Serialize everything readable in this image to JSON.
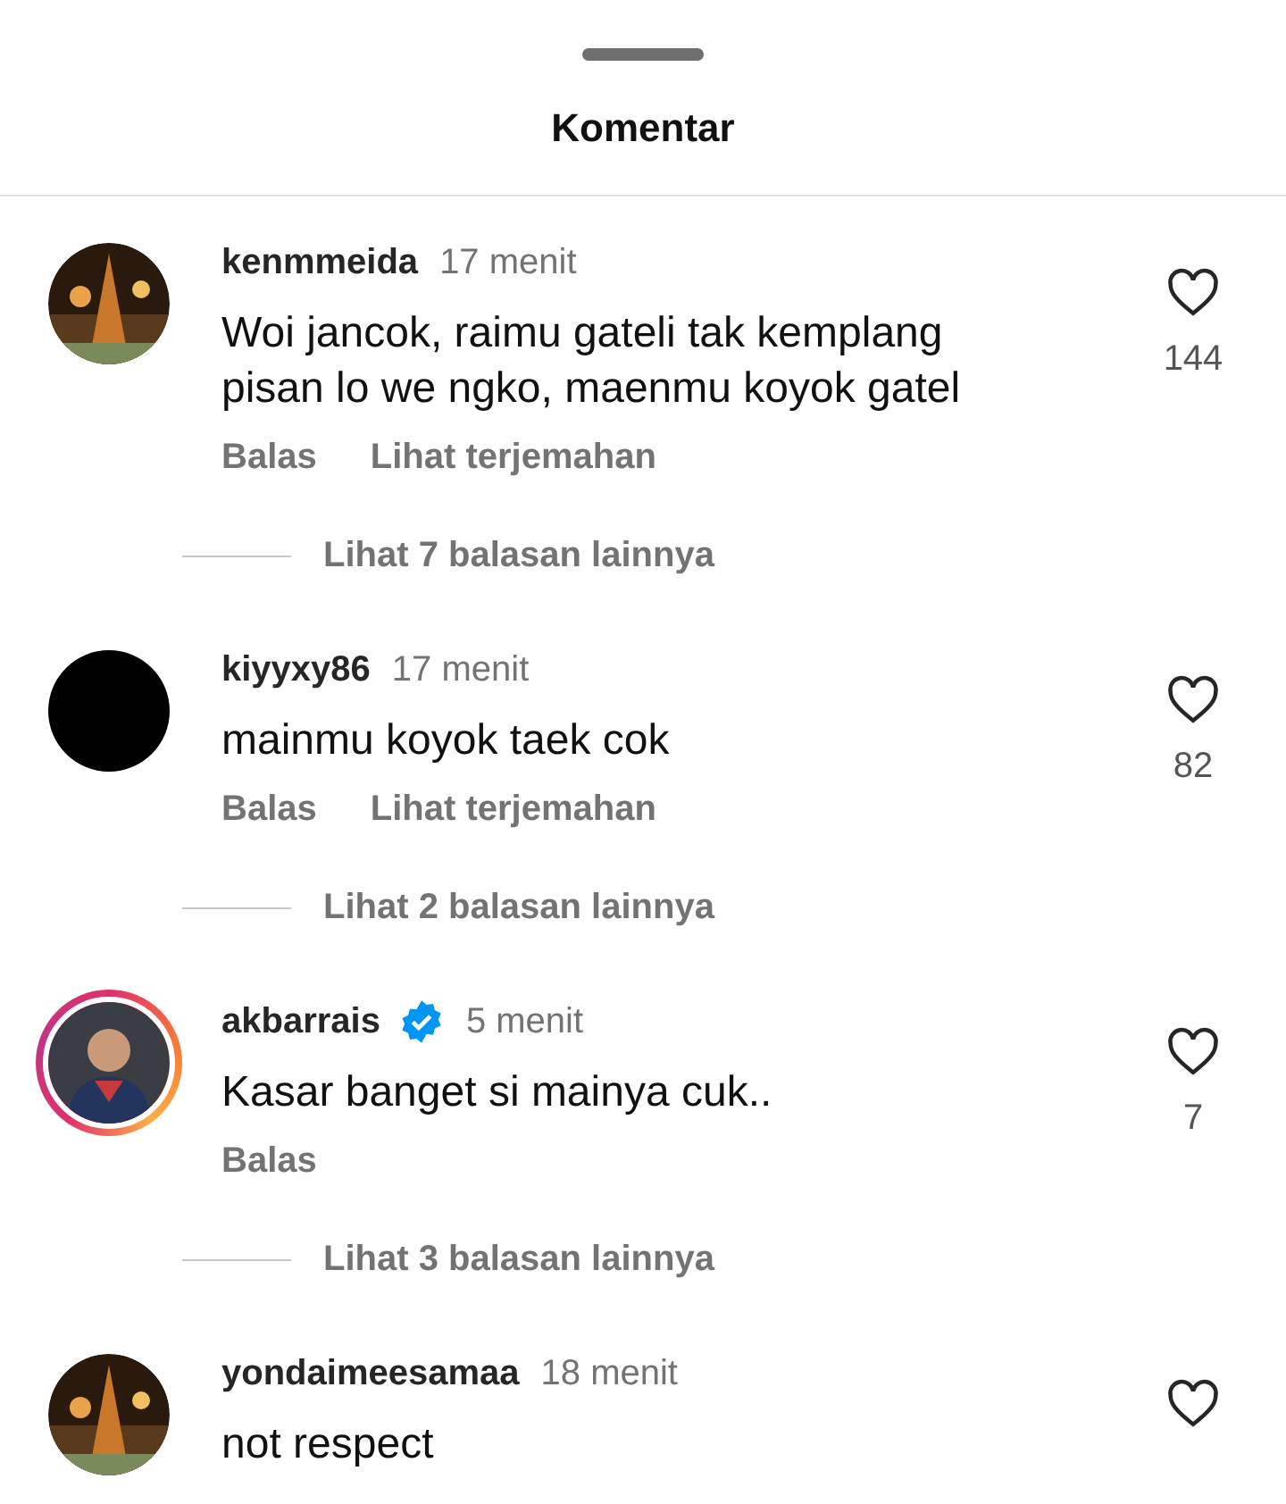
{
  "sheet": {
    "title": "Komentar"
  },
  "comments": [
    {
      "username": "kenmmeida",
      "verified": false,
      "time": "17 menit",
      "text": "Woi jancok, raimu gateli tak kemplang pisan lo we ngko, maenmu koyok gatel",
      "actions": [
        "Balas",
        "Lihat terjemahan"
      ],
      "likes": "144",
      "replies": "Lihat 7 balasan lainnya"
    },
    {
      "username": "kiyyxy86",
      "verified": false,
      "time": "17 menit",
      "text": "mainmu koyok taek cok",
      "actions": [
        "Balas",
        "Lihat terjemahan"
      ],
      "likes": "82",
      "avatar": {
        "kind": "plain",
        "story": false
      },
      "replies": "Lihat 2 balasan lainnya"
    },
    {
      "username": "akbarrais",
      "verified": true,
      "time": "5 menit",
      "text": "Kasar banget si mainya cuk..",
      "actions": [
        "Balas"
      ],
      "likes": "7",
      "avatar": {
        "kind": "person",
        "story": true
      },
      "replies": "Lihat 3 balasan lainnya"
    },
    {
      "username": "yondaimeesamaa",
      "verified": false,
      "time": "18 menit",
      "text": "not respect"
    }
  ]
}
